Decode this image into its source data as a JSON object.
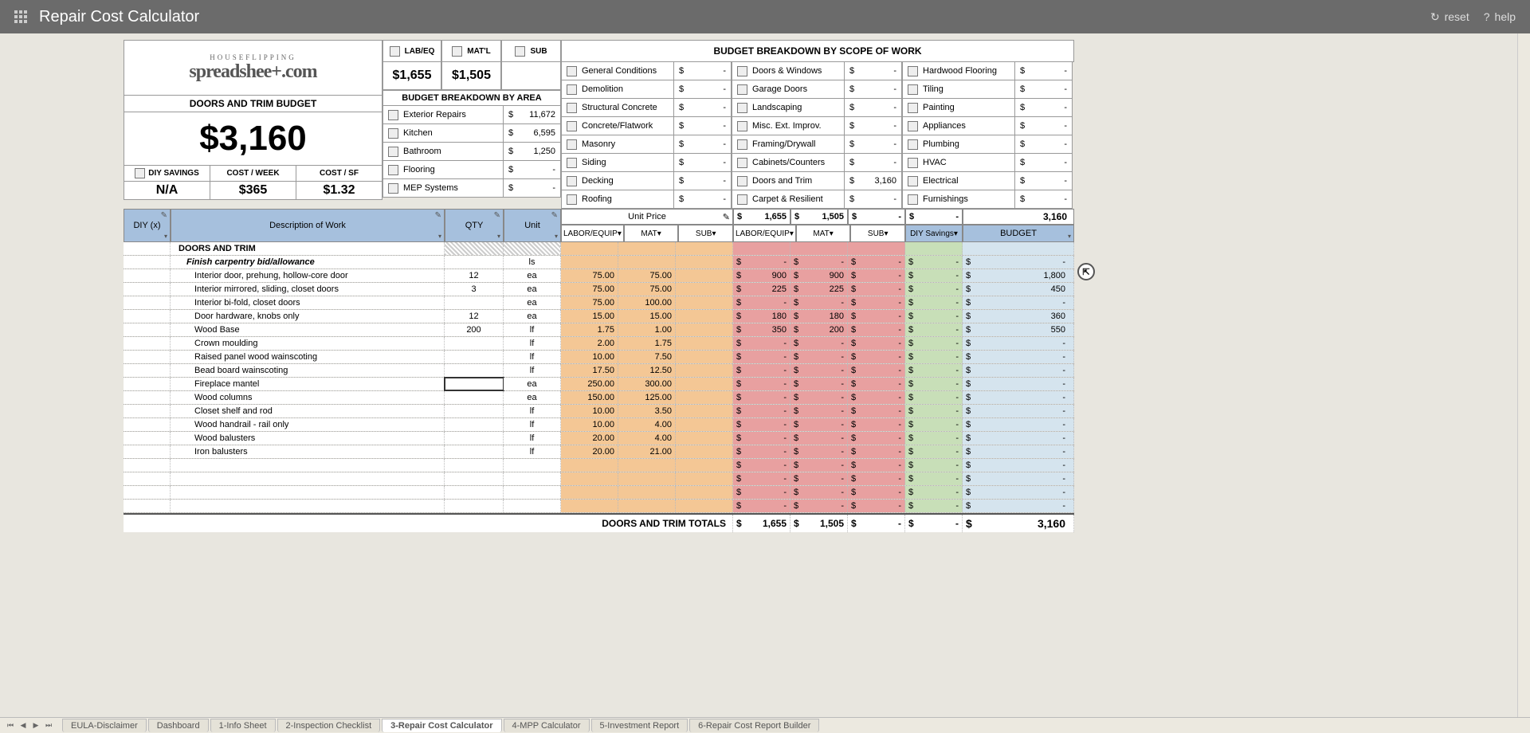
{
  "app": {
    "title": "Repair Cost Calculator",
    "reset": "reset",
    "help": "help"
  },
  "logo": {
    "line1": "HOUSEFLIPPING",
    "line2": "spreadshee+.com"
  },
  "budget": {
    "title": "DOORS AND TRIM BUDGET",
    "amount": "$3,160"
  },
  "stats": {
    "headers": [
      "DIY SAVINGS",
      "COST / WEEK",
      "COST / SF"
    ],
    "values": [
      "N/A",
      "$365",
      "$1.32"
    ]
  },
  "lms": {
    "labels": [
      "LAB/EQ",
      "MAT'L",
      "SUB"
    ],
    "values": [
      "$1,655",
      "$1,505",
      ""
    ]
  },
  "area": {
    "header": "BUDGET BREAKDOWN BY AREA",
    "rows": [
      {
        "label": "Exterior Repairs",
        "val": "11,672"
      },
      {
        "label": "Kitchen",
        "val": "6,595"
      },
      {
        "label": "Bathroom",
        "val": "1,250"
      },
      {
        "label": "Flooring",
        "val": "-"
      },
      {
        "label": "MEP Systems",
        "val": "-"
      }
    ]
  },
  "scope": {
    "header": "BUDGET BREAKDOWN BY SCOPE OF WORK",
    "cols": [
      [
        {
          "label": "General Conditions",
          "val": "-"
        },
        {
          "label": "Demolition",
          "val": "-"
        },
        {
          "label": "Structural Concrete",
          "val": "-"
        },
        {
          "label": "Concrete/Flatwork",
          "val": "-"
        },
        {
          "label": "Masonry",
          "val": "-"
        },
        {
          "label": "Siding",
          "val": "-"
        },
        {
          "label": "Decking",
          "val": "-"
        },
        {
          "label": "Roofing",
          "val": "-"
        }
      ],
      [
        {
          "label": "Doors & Windows",
          "val": "-"
        },
        {
          "label": "Garage Doors",
          "val": "-"
        },
        {
          "label": "Landscaping",
          "val": "-"
        },
        {
          "label": "Misc. Ext. Improv.",
          "val": "-"
        },
        {
          "label": "Framing/Drywall",
          "val": "-"
        },
        {
          "label": "Cabinets/Counters",
          "val": "-"
        },
        {
          "label": "Doors and Trim",
          "val": "3,160"
        },
        {
          "label": "Carpet & Resilient",
          "val": "-"
        }
      ],
      [
        {
          "label": "Hardwood Flooring",
          "val": "-"
        },
        {
          "label": "Tiling",
          "val": "-"
        },
        {
          "label": "Painting",
          "val": "-"
        },
        {
          "label": "Appliances",
          "val": "-"
        },
        {
          "label": "Plumbing",
          "val": "-"
        },
        {
          "label": "HVAC",
          "val": "-"
        },
        {
          "label": "Electrical",
          "val": "-"
        },
        {
          "label": "Furnishings",
          "val": "-"
        }
      ]
    ]
  },
  "colheads": {
    "diy": "DIY (x)",
    "desc": "Description of Work",
    "qty": "QTY",
    "unit": "Unit",
    "unitprice": "Unit Price",
    "labor": "LABOR/EQUIP",
    "mat": "MAT",
    "sub": "SUB",
    "diysav": "DIY Savings",
    "budget": "BUDGET",
    "tot1": "1,655",
    "tot2": "1,505",
    "tot3": "-",
    "tot4": "-",
    "tot5": "3,160"
  },
  "section": "DOORS AND TRIM",
  "subsection": "Finish carpentry bid/allowance",
  "subsection_unit": "ls",
  "rows": [
    {
      "desc": "Interior door, prehung, hollow-core door",
      "qty": "12",
      "unit": "ea",
      "up1": "75.00",
      "up2": "75.00",
      "t1": "900",
      "t2": "900",
      "t3": "-",
      "ds": "-",
      "b": "1,800"
    },
    {
      "desc": "Interior mirrored, sliding, closet doors",
      "qty": "3",
      "unit": "ea",
      "up1": "75.00",
      "up2": "75.00",
      "t1": "225",
      "t2": "225",
      "t3": "-",
      "ds": "-",
      "b": "450"
    },
    {
      "desc": "Interior bi-fold, closet doors",
      "qty": "",
      "unit": "ea",
      "up1": "75.00",
      "up2": "100.00",
      "t1": "-",
      "t2": "-",
      "t3": "-",
      "ds": "-",
      "b": "-"
    },
    {
      "desc": "Door hardware, knobs only",
      "qty": "12",
      "unit": "ea",
      "up1": "15.00",
      "up2": "15.00",
      "t1": "180",
      "t2": "180",
      "t3": "-",
      "ds": "-",
      "b": "360"
    },
    {
      "desc": "Wood Base",
      "qty": "200",
      "unit": "lf",
      "up1": "1.75",
      "up2": "1.00",
      "t1": "350",
      "t2": "200",
      "t3": "-",
      "ds": "-",
      "b": "550"
    },
    {
      "desc": "Crown moulding",
      "qty": "",
      "unit": "lf",
      "up1": "2.00",
      "up2": "1.75",
      "t1": "-",
      "t2": "-",
      "t3": "-",
      "ds": "-",
      "b": "-"
    },
    {
      "desc": "Raised panel wood wainscoting",
      "qty": "",
      "unit": "lf",
      "up1": "10.00",
      "up2": "7.50",
      "t1": "-",
      "t2": "-",
      "t3": "-",
      "ds": "-",
      "b": "-"
    },
    {
      "desc": "Bead board wainscoting",
      "qty": "",
      "unit": "lf",
      "up1": "17.50",
      "up2": "12.50",
      "t1": "-",
      "t2": "-",
      "t3": "-",
      "ds": "-",
      "b": "-"
    },
    {
      "desc": "Fireplace mantel",
      "qty": "",
      "unit": "ea",
      "up1": "250.00",
      "up2": "300.00",
      "t1": "-",
      "t2": "-",
      "t3": "-",
      "ds": "-",
      "b": "-",
      "selected": true
    },
    {
      "desc": "Wood columns",
      "qty": "",
      "unit": "ea",
      "up1": "150.00",
      "up2": "125.00",
      "t1": "-",
      "t2": "-",
      "t3": "-",
      "ds": "-",
      "b": "-"
    },
    {
      "desc": "Closet shelf and rod",
      "qty": "",
      "unit": "lf",
      "up1": "10.00",
      "up2": "3.50",
      "t1": "-",
      "t2": "-",
      "t3": "-",
      "ds": "-",
      "b": "-"
    },
    {
      "desc": "Wood handrail - rail only",
      "qty": "",
      "unit": "lf",
      "up1": "10.00",
      "up2": "4.00",
      "t1": "-",
      "t2": "-",
      "t3": "-",
      "ds": "-",
      "b": "-"
    },
    {
      "desc": "Wood balusters",
      "qty": "",
      "unit": "lf",
      "up1": "20.00",
      "up2": "4.00",
      "t1": "-",
      "t2": "-",
      "t3": "-",
      "ds": "-",
      "b": "-"
    },
    {
      "desc": "Iron balusters",
      "qty": "",
      "unit": "lf",
      "up1": "20.00",
      "up2": "21.00",
      "t1": "-",
      "t2": "-",
      "t3": "-",
      "ds": "-",
      "b": "-"
    },
    {
      "desc": "",
      "qty": "",
      "unit": "",
      "up1": "",
      "up2": "",
      "t1": "-",
      "t2": "-",
      "t3": "-",
      "ds": "-",
      "b": "-"
    },
    {
      "desc": "",
      "qty": "",
      "unit": "",
      "up1": "",
      "up2": "",
      "t1": "-",
      "t2": "-",
      "t3": "-",
      "ds": "-",
      "b": "-"
    },
    {
      "desc": "",
      "qty": "",
      "unit": "",
      "up1": "",
      "up2": "",
      "t1": "-",
      "t2": "-",
      "t3": "-",
      "ds": "-",
      "b": "-"
    },
    {
      "desc": "",
      "qty": "",
      "unit": "",
      "up1": "",
      "up2": "",
      "t1": "-",
      "t2": "-",
      "t3": "-",
      "ds": "-",
      "b": "-"
    }
  ],
  "totals": {
    "label": "DOORS AND TRIM TOTALS",
    "t1": "1,655",
    "t2": "1,505",
    "t3": "-",
    "ds": "-",
    "b": "3,160"
  },
  "tabs": [
    "EULA-Disclaimer",
    "Dashboard",
    "1-Info Sheet",
    "2-Inspection Checklist",
    "3-Repair Cost Calculator",
    "4-MPP Calculator",
    "5-Investment Report",
    "6-Repair Cost Report Builder"
  ],
  "active_tab": 4
}
